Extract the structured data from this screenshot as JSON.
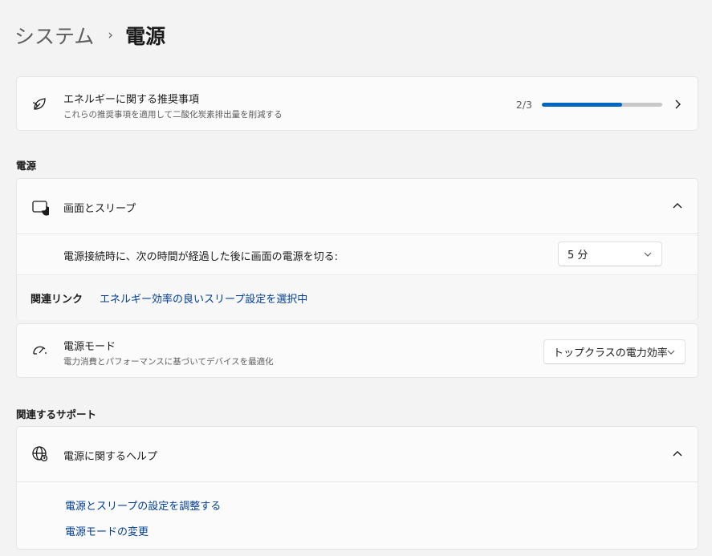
{
  "breadcrumb": {
    "parent": "システム",
    "separator": "›",
    "current": "電源"
  },
  "recommendation": {
    "title": "エネルギーに関する推奨事項",
    "subtitle": "これらの推奨事項を適用して二酸化炭素排出量を削減する",
    "progress_text": "2/3",
    "progress_fraction": 0.667,
    "icon": "leaf-icon"
  },
  "sections": {
    "power": "電源",
    "support": "関連するサポート"
  },
  "screen_sleep": {
    "title": "画面とスリープ",
    "icon": "screen-sleep-icon",
    "setting_label": "電源接続時に、次の時間が経過した後に画面の電源を切る:",
    "setting_value": "5 分",
    "related_label": "関連リンク",
    "related_link": "エネルギー効率の良いスリープ設定を選択中"
  },
  "power_mode": {
    "title": "電源モード",
    "subtitle": "電力消費とパフォーマンスに基づいてデバイスを最適化",
    "value": "トップクラスの電力効率",
    "icon": "gauge-icon"
  },
  "help": {
    "title": "電源に関するヘルプ",
    "icon": "globe-icon",
    "links": [
      "電源とスリープの設定を調整する",
      "電源モードの変更"
    ]
  },
  "colors": {
    "accent": "#0067c0",
    "link": "#003e92",
    "background": "#f3f3f3",
    "card": "#fbfbfb"
  }
}
